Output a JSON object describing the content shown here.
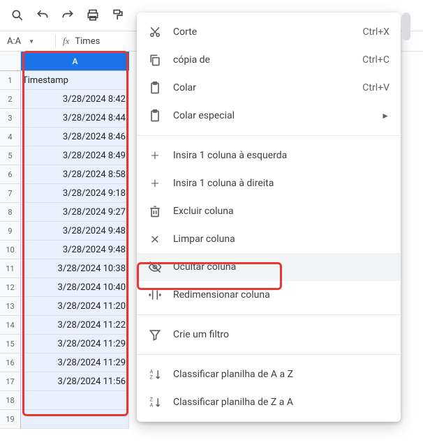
{
  "namebox": {
    "ref": "A:A",
    "fx_label": "fx",
    "fx_value": "Times"
  },
  "column_header": "A",
  "header_cell": "Timestamp",
  "rows": [
    "3/28/2024 8:42",
    "3/28/2024 8:44",
    "3/28/2024 8:46",
    "3/28/2024 8:49",
    "3/28/2024 8:58",
    "3/28/2024 9:18",
    "3/28/2024 9:27",
    "3/28/2024 9:48",
    "3/28/2024 9:48",
    "3/28/2024 10:38",
    "3/28/2024 10:40",
    "3/28/2024 11:20",
    "3/28/2024 11:22",
    "3/28/2024 11:29",
    "3/28/2024 11:29",
    "3/28/2024 11:56"
  ],
  "empty_rows": [
    18,
    19
  ],
  "menu": {
    "cut": {
      "label": "Corte",
      "shortcut": "Ctrl+X"
    },
    "copy": {
      "label": "cópia de",
      "shortcut": "Ctrl+C"
    },
    "paste": {
      "label": "Colar",
      "shortcut": "Ctrl+V"
    },
    "paste_special": {
      "label": "Colar especial",
      "submenu": "►"
    },
    "insert_left": {
      "label": "Insira 1 coluna à esquerda"
    },
    "insert_right": {
      "label": "Insira 1 coluna à direita"
    },
    "delete_col": {
      "label": "Excluir coluna"
    },
    "clear_col": {
      "label": "Limpar coluna"
    },
    "hide_col": {
      "label": "Ocultar coluna"
    },
    "resize_col": {
      "label": "Redimensionar coluna"
    },
    "create_filter": {
      "label": "Crie um filtro"
    },
    "sort_az": {
      "label": "Classificar planilha de A a Z"
    },
    "sort_za": {
      "label": "Classificar planilha de Z a A"
    }
  }
}
